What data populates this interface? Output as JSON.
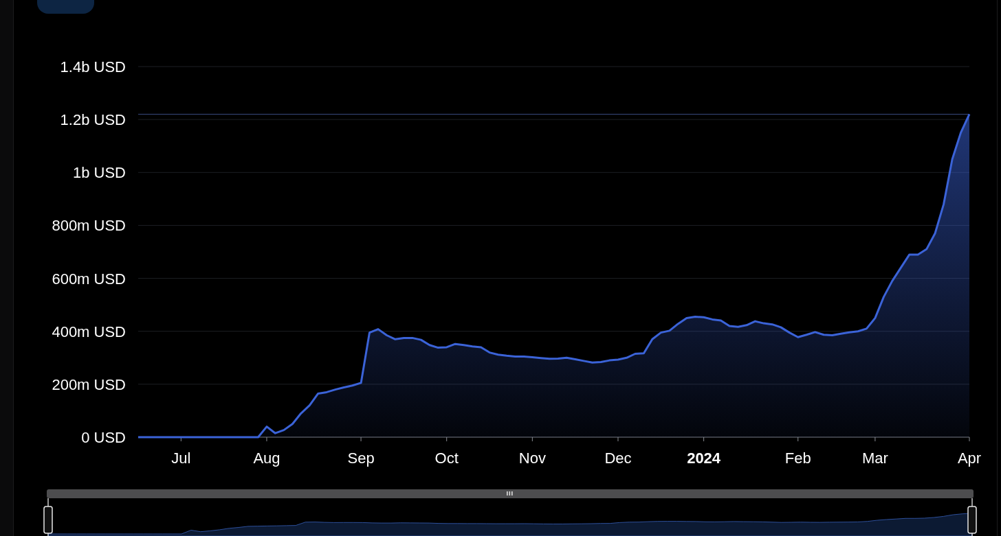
{
  "chart_data": {
    "type": "area",
    "categories": [
      null,
      null,
      null,
      null,
      null,
      "Jul",
      null,
      null,
      null,
      null,
      null,
      null,
      null,
      null,
      null,
      "Aug",
      null,
      null,
      null,
      null,
      null,
      null,
      null,
      null,
      null,
      null,
      "Sep",
      null,
      null,
      null,
      null,
      null,
      null,
      null,
      null,
      null,
      "Oct",
      null,
      null,
      null,
      null,
      null,
      null,
      null,
      null,
      null,
      "Nov",
      null,
      null,
      null,
      null,
      null,
      null,
      null,
      null,
      null,
      "Dec",
      null,
      null,
      null,
      null,
      null,
      null,
      null,
      null,
      null,
      "**2024**",
      null,
      null,
      null,
      null,
      null,
      null,
      null,
      null,
      null,
      null,
      "Feb",
      null,
      null,
      null,
      null,
      null,
      null,
      null,
      null,
      "Mar",
      null,
      null,
      null,
      null,
      null,
      null,
      null,
      null,
      null,
      null,
      "Apr"
    ],
    "series": [
      {
        "color": "#3b63d8",
        "values": [
          0,
          0,
          0,
          0,
          0,
          0,
          0,
          0,
          0,
          0,
          0,
          0,
          0,
          0,
          0,
          40000000,
          15000000,
          27000000,
          50000000,
          90000000,
          120000000,
          165000000,
          170000000,
          180000000,
          188000000,
          195000000,
          205000000,
          395000000,
          408000000,
          385000000,
          370000000,
          375000000,
          375000000,
          368000000,
          348000000,
          338000000,
          340000000,
          352000000,
          348000000,
          343000000,
          340000000,
          320000000,
          312000000,
          308000000,
          305000000,
          305000000,
          302000000,
          299000000,
          296000000,
          297000000,
          300000000,
          294000000,
          288000000,
          282000000,
          284000000,
          290000000,
          293000000,
          300000000,
          315000000,
          317000000,
          370000000,
          395000000,
          402000000,
          428000000,
          450000000,
          455000000,
          453000000,
          445000000,
          441000000,
          420000000,
          417000000,
          423000000,
          438000000,
          430000000,
          426000000,
          415000000,
          395000000,
          378000000,
          387000000,
          397000000,
          387000000,
          385000000,
          391000000,
          396000000,
          400000000,
          410000000,
          450000000,
          530000000,
          590000000,
          640000000,
          690000000,
          690000000,
          710000000,
          770000000,
          880000000,
          1050000000,
          1150000000,
          1220000000
        ]
      }
    ],
    "ylim": [
      0,
      1400000000
    ],
    "grid": true,
    "ref_lines": [
      {
        "axis": "y",
        "value": 1220000000
      }
    ],
    "yticks": [
      {
        "value": 0,
        "label": "0 USD"
      },
      {
        "value": 200000000,
        "label": "200m USD"
      },
      {
        "value": 400000000,
        "label": "400m USD"
      },
      {
        "value": 600000000,
        "label": "600m USD"
      },
      {
        "value": 800000000,
        "label": "800m USD"
      },
      {
        "value": 1000000000,
        "label": "1b USD"
      },
      {
        "value": 1200000000,
        "label": "1.2b USD"
      },
      {
        "value": 1400000000,
        "label": "1.4b USD"
      }
    ]
  }
}
